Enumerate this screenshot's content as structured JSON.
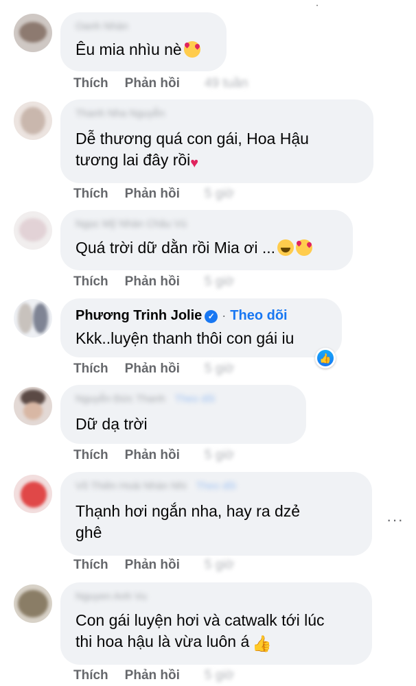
{
  "actions": {
    "like": "Thích",
    "reply": "Phản hồi"
  },
  "comments": [
    {
      "author": "Oanh Nhàn",
      "text_lines": [
        "Êu mia nhìu nè"
      ],
      "emoji": "smiling-face-with-hearts",
      "time": "49 tuần"
    },
    {
      "author": "Thanh Nha Nguyễn",
      "text_lines": [
        "Dễ thương quá con gái, Hoa Hậu",
        "tương lai đây rồi"
      ],
      "emoji": "two-hearts",
      "time": "5 giờ"
    },
    {
      "author": "Ngọc Mỹ Nhàn Châu Vú",
      "text_lines": [
        "Quá trời dữ dằn rồi Mia ơi ..."
      ],
      "emoji": "laughing-and-hearts",
      "time": "5 giờ"
    },
    {
      "author": "Phương Trinh Jolie",
      "verified": true,
      "separator": "·",
      "follow": "Theo dõi",
      "text_lines": [
        "Kkk..luyện thanh thôi con gái iu"
      ],
      "reaction": "like",
      "time": "5 giờ"
    },
    {
      "author": "Nguyễn Đức Thanh",
      "follow_hint": "Theo dõi",
      "text_lines": [
        "Dữ dạ trời"
      ],
      "time": "5 giờ"
    },
    {
      "author": "Võ Thiên Hoài Nhàn Nhi",
      "follow_hint": "Theo dõi",
      "text_lines": [
        "Thạnh hơi ngắn nha, hay ra dzẻ",
        "ghê"
      ],
      "time": "5 giờ"
    },
    {
      "author": "Nguyen Anh Vu",
      "text_lines": [
        "Con gái luyện hơi và catwalk tới lúc",
        "thi hoa hậu là vừa luôn á"
      ],
      "emoji": "thumbs-up",
      "time": "5 giờ"
    }
  ],
  "more_icon": "···",
  "colors": {
    "bubble": "#f0f2f5",
    "link": "#1877f2",
    "meta": "#65676b",
    "text": "#050505"
  }
}
